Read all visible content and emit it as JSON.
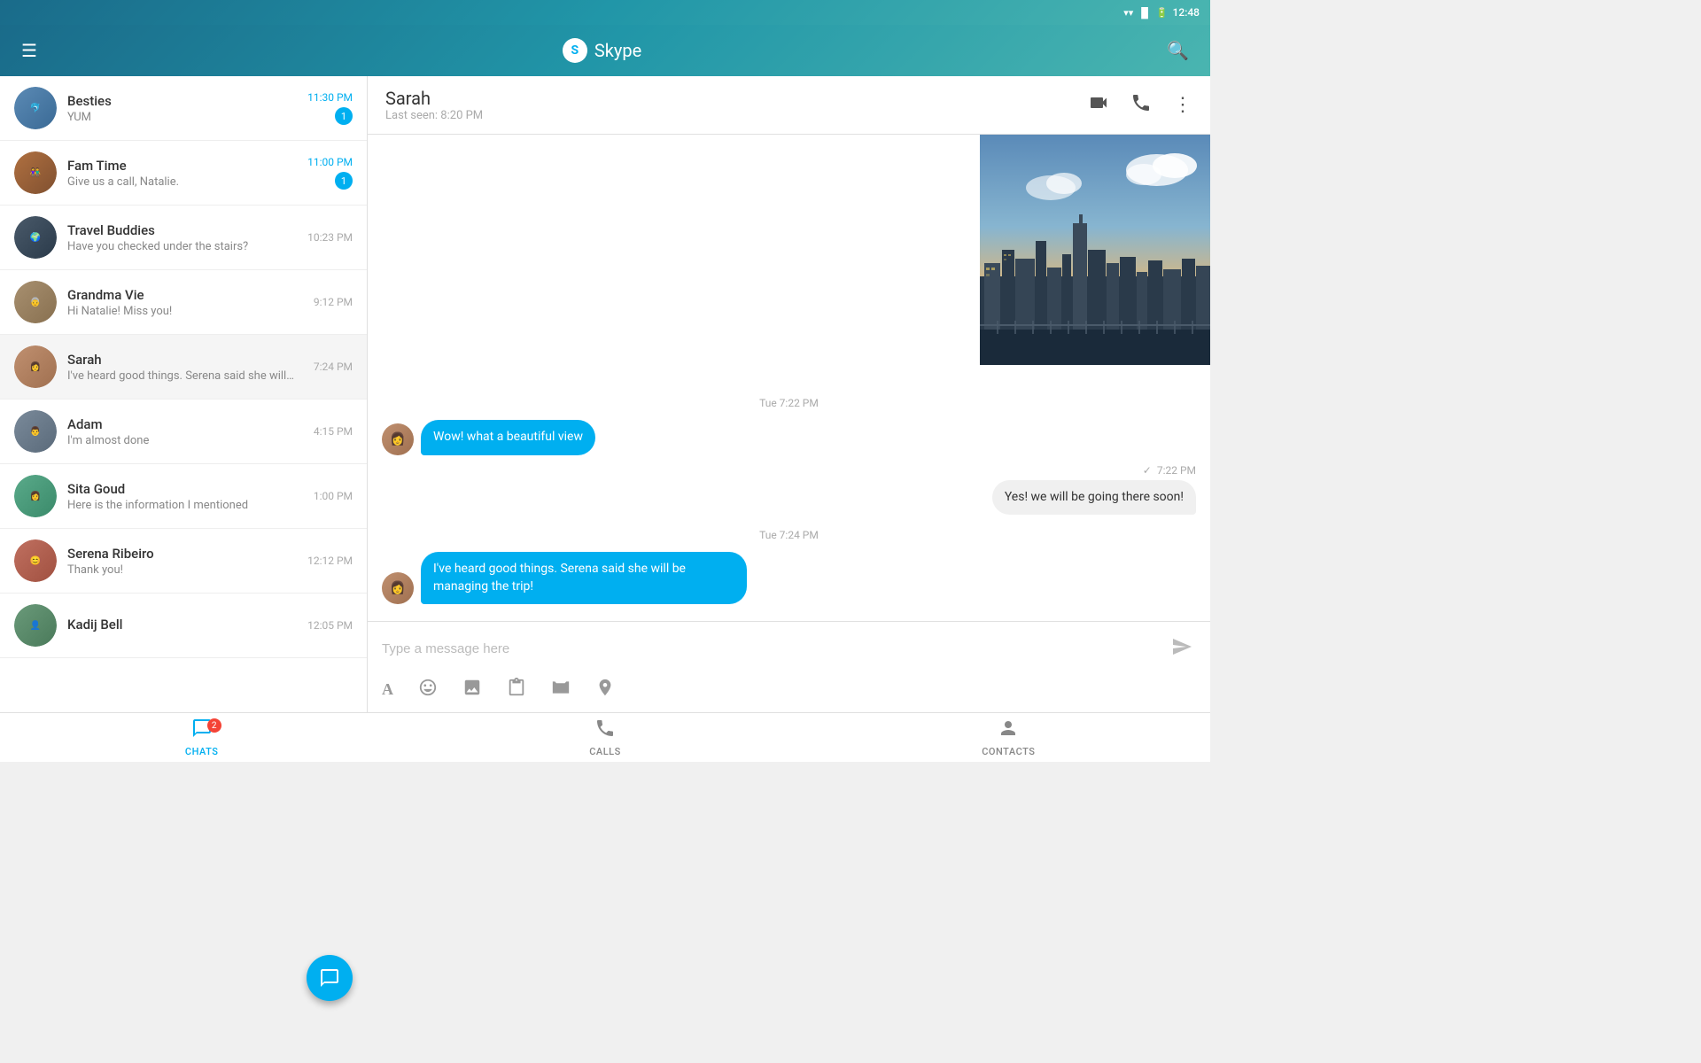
{
  "statusBar": {
    "time": "12:48",
    "icons": [
      "wifi",
      "signal",
      "battery"
    ]
  },
  "header": {
    "menu": "☰",
    "appName": "Skype",
    "skypeLogo": "S",
    "searchIcon": "🔍"
  },
  "chatList": {
    "items": [
      {
        "id": 1,
        "name": "Besties",
        "preview": "YUM",
        "time": "11:30 PM",
        "unread": 1,
        "timeHighlight": true,
        "avatarColor": "av-blue"
      },
      {
        "id": 2,
        "name": "Fam Time",
        "preview": "Give us a call, Natalie.",
        "time": "11:00 PM",
        "unread": 1,
        "timeHighlight": true,
        "avatarColor": "av-teal"
      },
      {
        "id": 3,
        "name": "Travel Buddies",
        "preview": "Have you checked under the stairs?",
        "time": "10:23 PM",
        "unread": 0,
        "timeHighlight": false,
        "avatarColor": "av-dark"
      },
      {
        "id": 4,
        "name": "Grandma Vie",
        "preview": "Hi Natalie! Miss you!",
        "time": "9:12 PM",
        "unread": 0,
        "timeHighlight": false,
        "avatarColor": "av-gray"
      },
      {
        "id": 5,
        "name": "Sarah",
        "preview": "I've heard good things. Serena said she will…",
        "time": "7:24 PM",
        "unread": 0,
        "timeHighlight": false,
        "avatarColor": "av-brown",
        "active": true
      },
      {
        "id": 6,
        "name": "Adam",
        "preview": "I'm almost done",
        "time": "4:15 PM",
        "unread": 0,
        "timeHighlight": false,
        "avatarColor": "av-dark"
      },
      {
        "id": 7,
        "name": "Sita Goud",
        "preview": "Here is the information I mentioned",
        "time": "1:00 PM",
        "unread": 0,
        "timeHighlight": false,
        "avatarColor": "av-teal"
      },
      {
        "id": 8,
        "name": "Serena Ribeiro",
        "preview": "Thank you!",
        "time": "12:12 PM",
        "unread": 0,
        "timeHighlight": false,
        "avatarColor": "av-red"
      },
      {
        "id": 9,
        "name": "Kadij Bell",
        "preview": "",
        "time": "12:05 PM",
        "unread": 0,
        "timeHighlight": false,
        "avatarColor": "av-green"
      }
    ]
  },
  "chatWindow": {
    "contactName": "Sarah",
    "lastSeen": "Last seen: 8:20 PM",
    "messages": [
      {
        "type": "received",
        "timestamp": "Tue 7:22 PM",
        "text": "Wow! what a beautiful view",
        "avatarColor": "av-brown"
      },
      {
        "type": "sent",
        "timestamp": "7:22 PM",
        "text": "Yes! we will be going there soon!"
      },
      {
        "type": "received",
        "timestamp": "Tue 7:24 PM",
        "text": "I've heard good things. Serena said she will be managing the trip!",
        "avatarColor": "av-brown"
      }
    ],
    "inputPlaceholder": "Type a message here"
  },
  "bottomNav": {
    "items": [
      {
        "id": "chats",
        "label": "CHATS",
        "icon": "💬",
        "badge": 2,
        "active": true
      },
      {
        "id": "calls",
        "label": "CALLS",
        "icon": "📞",
        "badge": 0,
        "active": false
      },
      {
        "id": "contacts",
        "label": "CONTACTS",
        "icon": "👤",
        "badge": 0,
        "active": false
      }
    ]
  },
  "toolbar": {
    "icons": [
      "A",
      "😊",
      "🖼",
      "📋",
      "📷",
      "📍"
    ]
  }
}
